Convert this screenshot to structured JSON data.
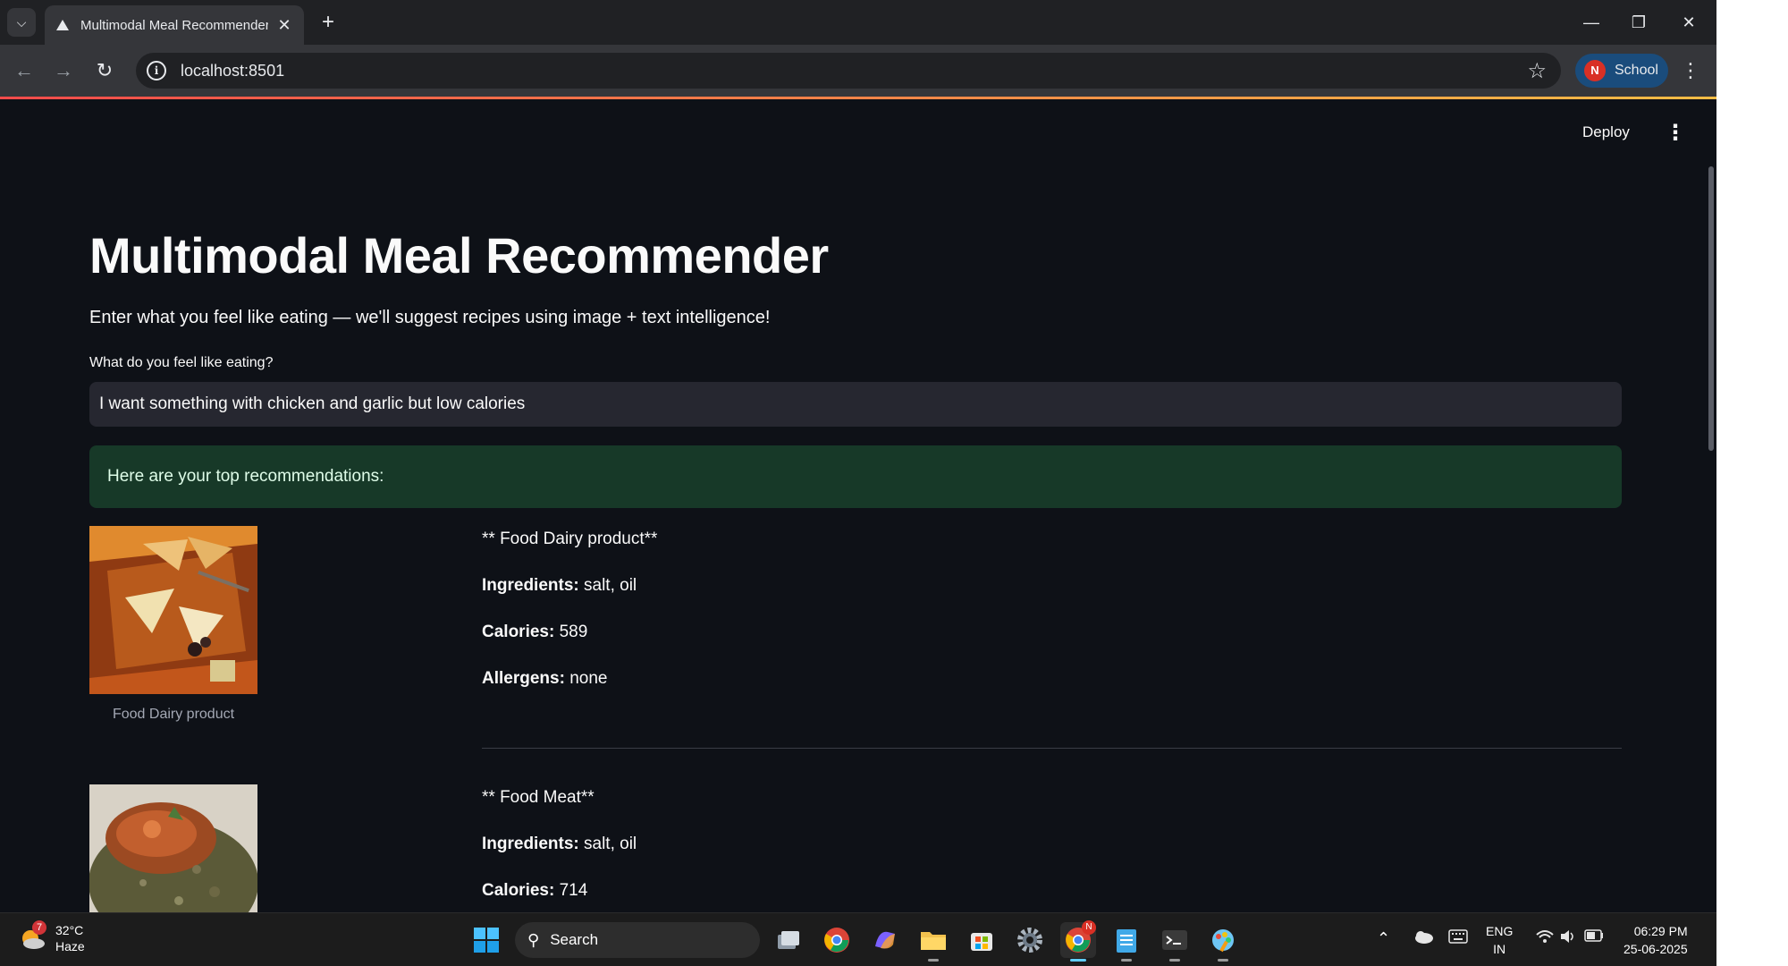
{
  "browser": {
    "tab_title": "Multimodal Meal Recommender",
    "url": "localhost:8501",
    "profile_initial": "N",
    "profile_name": "School"
  },
  "app": {
    "deploy_label": "Deploy",
    "title": "Multimodal Meal Recommender",
    "subtitle": "Enter what you feel like eating — we'll suggest recipes using image + text intelligence!",
    "input_label": "What do you feel like eating?",
    "input_value": "I want something with chicken and garlic but low calories",
    "success_message": "Here are your top recommendations:",
    "recommendations": [
      {
        "heading": "** Food Dairy product**",
        "ingredients_label": "Ingredients:",
        "ingredients": " salt, oil",
        "calories_label": "Calories:",
        "calories": " 589",
        "allergens_label": "Allergens:",
        "allergens": " none",
        "caption": "Food Dairy product"
      },
      {
        "heading": "** Food Meat**",
        "ingredients_label": "Ingredients:",
        "ingredients": " salt, oil",
        "calories_label": "Calories:",
        "calories": " 714"
      }
    ]
  },
  "taskbar": {
    "weather_temp": "32°C",
    "weather_desc": "Haze",
    "weather_badge": "7",
    "search_label": "Search",
    "lang_top": "ENG",
    "lang_bottom": "IN",
    "time": "06:29 PM",
    "date": "25-06-2025",
    "chrome_badge": "N"
  },
  "colors": {
    "app_bg": "#0e1117",
    "input_bg": "#262730",
    "success_bg": "#173928",
    "accent": "#ff4b4b"
  }
}
